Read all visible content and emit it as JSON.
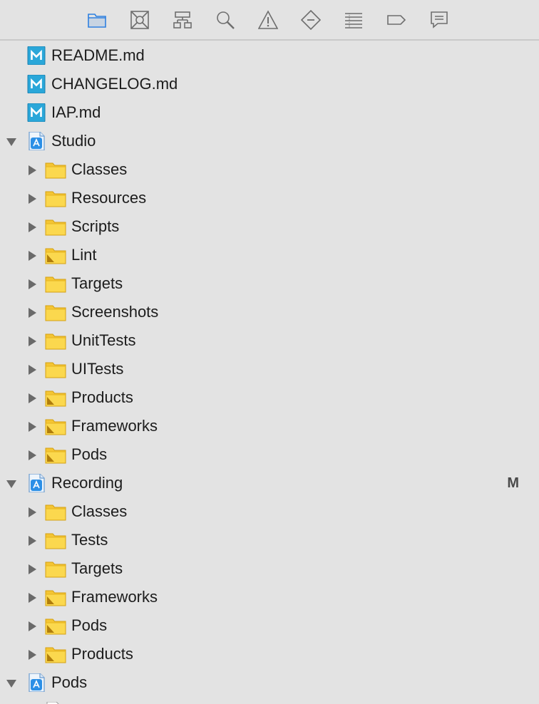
{
  "toolbar": {
    "tabs": [
      {
        "name": "folder-icon",
        "selected": true
      },
      {
        "name": "source-control-icon",
        "selected": false
      },
      {
        "name": "hierarchy-icon",
        "selected": false
      },
      {
        "name": "search-icon",
        "selected": false
      },
      {
        "name": "warning-icon",
        "selected": false
      },
      {
        "name": "test-diamond-icon",
        "selected": false
      },
      {
        "name": "debug-list-icon",
        "selected": false
      },
      {
        "name": "breakpoint-tag-icon",
        "selected": false
      },
      {
        "name": "report-bubble-icon",
        "selected": false
      }
    ],
    "accent": "#2d7fe0"
  },
  "tree": {
    "items": [
      {
        "label": "README.md",
        "icon": "markdown-file-icon",
        "level": 1,
        "disclosure": "none"
      },
      {
        "label": "CHANGELOG.md",
        "icon": "markdown-file-icon",
        "level": 1,
        "disclosure": "none"
      },
      {
        "label": "IAP.md",
        "icon": "markdown-file-icon",
        "level": 1,
        "disclosure": "none"
      },
      {
        "label": "Studio",
        "icon": "project-icon",
        "level": 0,
        "disclosure": "open"
      },
      {
        "label": "Classes",
        "icon": "folder-icon",
        "level": 1,
        "disclosure": "closed"
      },
      {
        "label": "Resources",
        "icon": "folder-icon",
        "level": 1,
        "disclosure": "closed"
      },
      {
        "label": "Scripts",
        "icon": "folder-icon",
        "level": 1,
        "disclosure": "closed"
      },
      {
        "label": "Lint",
        "icon": "group-folder-icon",
        "level": 1,
        "disclosure": "closed"
      },
      {
        "label": "Targets",
        "icon": "folder-icon",
        "level": 1,
        "disclosure": "closed"
      },
      {
        "label": "Screenshots",
        "icon": "folder-icon",
        "level": 1,
        "disclosure": "closed"
      },
      {
        "label": "UnitTests",
        "icon": "folder-icon",
        "level": 1,
        "disclosure": "closed"
      },
      {
        "label": "UITests",
        "icon": "folder-icon",
        "level": 1,
        "disclosure": "closed"
      },
      {
        "label": "Products",
        "icon": "group-folder-icon",
        "level": 1,
        "disclosure": "closed"
      },
      {
        "label": "Frameworks",
        "icon": "group-folder-icon",
        "level": 1,
        "disclosure": "closed"
      },
      {
        "label": "Pods",
        "icon": "group-folder-icon",
        "level": 1,
        "disclosure": "closed"
      },
      {
        "label": "Recording",
        "icon": "project-icon",
        "level": 0,
        "disclosure": "open",
        "badge": "M"
      },
      {
        "label": "Classes",
        "icon": "folder-icon",
        "level": 1,
        "disclosure": "closed"
      },
      {
        "label": "Tests",
        "icon": "folder-icon",
        "level": 1,
        "disclosure": "closed"
      },
      {
        "label": "Targets",
        "icon": "folder-icon",
        "level": 1,
        "disclosure": "closed"
      },
      {
        "label": "Frameworks",
        "icon": "group-folder-icon",
        "level": 1,
        "disclosure": "closed"
      },
      {
        "label": "Pods",
        "icon": "group-folder-icon",
        "level": 1,
        "disclosure": "closed"
      },
      {
        "label": "Products",
        "icon": "group-folder-icon",
        "level": 1,
        "disclosure": "closed"
      },
      {
        "label": "Pods",
        "icon": "project-icon",
        "level": 0,
        "disclosure": "open"
      },
      {
        "label": "",
        "icon": "file-icon",
        "level": 1,
        "disclosure": "none"
      }
    ]
  }
}
